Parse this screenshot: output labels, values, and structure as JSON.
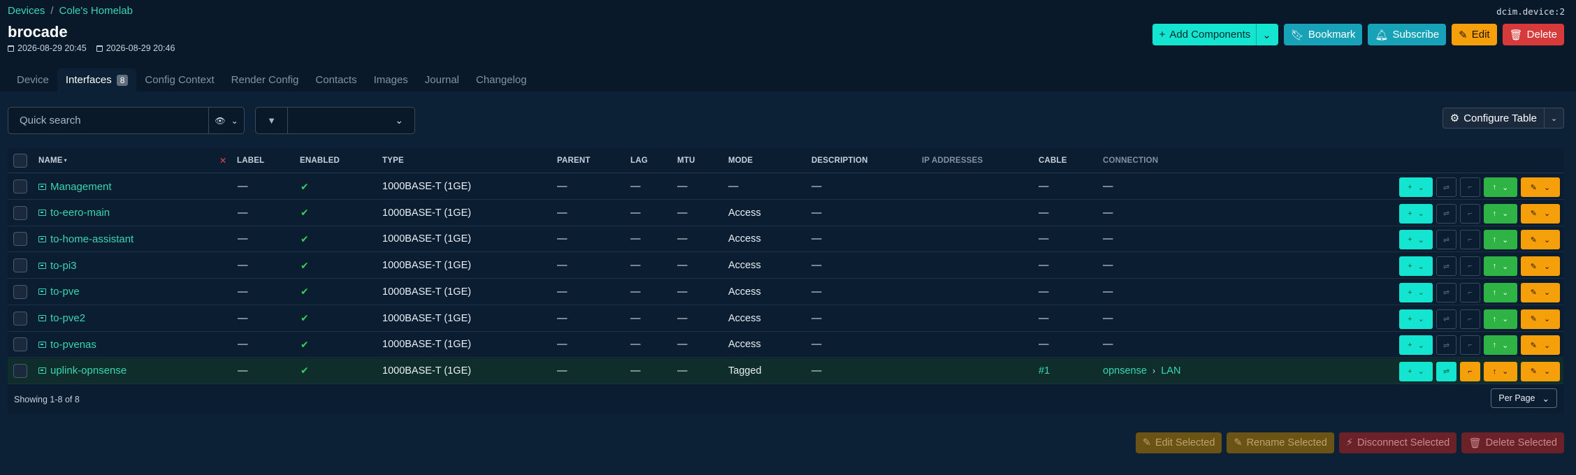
{
  "breadcrumb": {
    "items": [
      "Devices",
      "Cole's Homelab"
    ],
    "separator": "/"
  },
  "object_id": "dcim.device:2",
  "page_title": "brocade",
  "timestamps": {
    "created": "2026-08-29 20:45",
    "updated": "2026-08-29 20:46"
  },
  "top_actions": {
    "add_components": "Add Components",
    "bookmark": "Bookmark",
    "subscribe": "Subscribe",
    "edit": "Edit",
    "delete": "Delete"
  },
  "tabs": [
    {
      "label": "Device"
    },
    {
      "label": "Interfaces",
      "badge": "8",
      "active": true
    },
    {
      "label": "Config Context"
    },
    {
      "label": "Render Config"
    },
    {
      "label": "Contacts"
    },
    {
      "label": "Images"
    },
    {
      "label": "Journal"
    },
    {
      "label": "Changelog"
    }
  ],
  "toolbar": {
    "search_placeholder": "Quick search",
    "filter_value": "",
    "configure_table": "Configure Table"
  },
  "table": {
    "headers": {
      "name": "NAME",
      "label": "LABEL",
      "enabled": "ENABLED",
      "type": "TYPE",
      "parent": "PARENT",
      "lag": "LAG",
      "mtu": "MTU",
      "mode": "MODE",
      "description": "DESCRIPTION",
      "ip_addresses": "IP ADDRESSES",
      "cable": "CABLE",
      "connection": "CONNECTION"
    },
    "rows": [
      {
        "name": "Management",
        "label": "—",
        "enabled": "✔",
        "type": "1000BASE-T (1GE)",
        "parent": "—",
        "lag": "—",
        "mtu": "—",
        "mode": "—",
        "description": "—",
        "cable": "—",
        "connection": "—"
      },
      {
        "name": "to-eero-main",
        "label": "—",
        "enabled": "✔",
        "type": "1000BASE-T (1GE)",
        "parent": "—",
        "lag": "—",
        "mtu": "—",
        "mode": "Access",
        "description": "—",
        "cable": "—",
        "connection": "—"
      },
      {
        "name": "to-home-assistant",
        "label": "—",
        "enabled": "✔",
        "type": "1000BASE-T (1GE)",
        "parent": "—",
        "lag": "—",
        "mtu": "—",
        "mode": "Access",
        "description": "—",
        "cable": "—",
        "connection": "—"
      },
      {
        "name": "to-pi3",
        "label": "—",
        "enabled": "✔",
        "type": "1000BASE-T (1GE)",
        "parent": "—",
        "lag": "—",
        "mtu": "—",
        "mode": "Access",
        "description": "—",
        "cable": "—",
        "connection": "—"
      },
      {
        "name": "to-pve",
        "label": "—",
        "enabled": "✔",
        "type": "1000BASE-T (1GE)",
        "parent": "—",
        "lag": "—",
        "mtu": "—",
        "mode": "Access",
        "description": "—",
        "cable": "—",
        "connection": "—"
      },
      {
        "name": "to-pve2",
        "label": "—",
        "enabled": "✔",
        "type": "1000BASE-T (1GE)",
        "parent": "—",
        "lag": "—",
        "mtu": "—",
        "mode": "Access",
        "description": "—",
        "cable": "—",
        "connection": "—"
      },
      {
        "name": "to-pvenas",
        "label": "—",
        "enabled": "✔",
        "type": "1000BASE-T (1GE)",
        "parent": "—",
        "lag": "—",
        "mtu": "—",
        "mode": "Access",
        "description": "—",
        "cable": "—",
        "connection": "—"
      },
      {
        "name": "uplink-opnsense",
        "label": "—",
        "enabled": "✔",
        "type": "1000BASE-T (1GE)",
        "parent": "—",
        "lag": "—",
        "mtu": "—",
        "mode": "Tagged",
        "description": "—",
        "cable": "#1",
        "connection_device": "opnsense",
        "connection_port": "LAN"
      }
    ],
    "footer": "Showing 1-8 of 8",
    "per_page": "Per Page"
  },
  "bulk_actions": {
    "edit": "Edit Selected",
    "rename": "Rename Selected",
    "disconnect": "Disconnect Selected",
    "delete": "Delete Selected"
  },
  "colors": {
    "background": "#0a1929",
    "accent": "#3ad6b2",
    "primary_button": "#14e5d1",
    "warning": "#f59f0b",
    "danger": "#d63a3a",
    "success": "#2fb344"
  }
}
